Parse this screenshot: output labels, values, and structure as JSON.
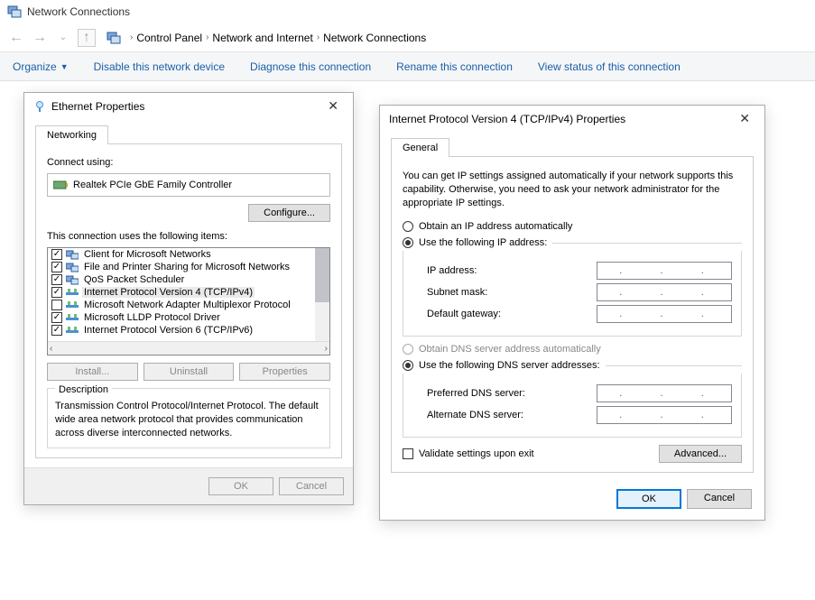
{
  "window": {
    "title": "Network Connections"
  },
  "breadcrumb": {
    "items": [
      "Control Panel",
      "Network and Internet",
      "Network Connections"
    ]
  },
  "toolbar": {
    "organize": "Organize",
    "disable": "Disable this network device",
    "diagnose": "Diagnose this connection",
    "rename": "Rename this connection",
    "viewstatus": "View status of this connection"
  },
  "ethDlg": {
    "title": "Ethernet Properties",
    "tab": "Networking",
    "connectUsing": "Connect using:",
    "adapter": "Realtek PCIe GbE Family Controller",
    "configure": "Configure...",
    "itemsLabel": "This connection uses the following items:",
    "items": [
      {
        "checked": true,
        "label": "Client for Microsoft Networks"
      },
      {
        "checked": true,
        "label": "File and Printer Sharing for Microsoft Networks"
      },
      {
        "checked": true,
        "label": "QoS Packet Scheduler"
      },
      {
        "checked": true,
        "label": "Internet Protocol Version 4 (TCP/IPv4)",
        "selected": true
      },
      {
        "checked": false,
        "label": "Microsoft Network Adapter Multiplexor Protocol"
      },
      {
        "checked": true,
        "label": "Microsoft LLDP Protocol Driver"
      },
      {
        "checked": true,
        "label": "Internet Protocol Version 6 (TCP/IPv6)"
      }
    ],
    "install": "Install...",
    "uninstall": "Uninstall",
    "properties": "Properties",
    "descTitle": "Description",
    "descText": "Transmission Control Protocol/Internet Protocol. The default wide area network protocol that provides communication across diverse interconnected networks.",
    "ok": "OK",
    "cancel": "Cancel"
  },
  "ipDlg": {
    "title": "Internet Protocol Version 4 (TCP/IPv4) Properties",
    "tab": "General",
    "info": "You can get IP settings assigned automatically if your network supports this capability. Otherwise, you need to ask your network administrator for the appropriate IP settings.",
    "obtainIpAuto": "Obtain an IP address automatically",
    "useIp": "Use the following IP address:",
    "ipAddress": "IP address:",
    "subnet": "Subnet mask:",
    "gateway": "Default gateway:",
    "obtainDnsAuto": "Obtain DNS server address automatically",
    "useDns": "Use the following DNS server addresses:",
    "prefDns": "Preferred DNS server:",
    "altDns": "Alternate DNS server:",
    "validate": "Validate settings upon exit",
    "advanced": "Advanced...",
    "ok": "OK",
    "cancel": "Cancel",
    "dots": ".       .       ."
  }
}
